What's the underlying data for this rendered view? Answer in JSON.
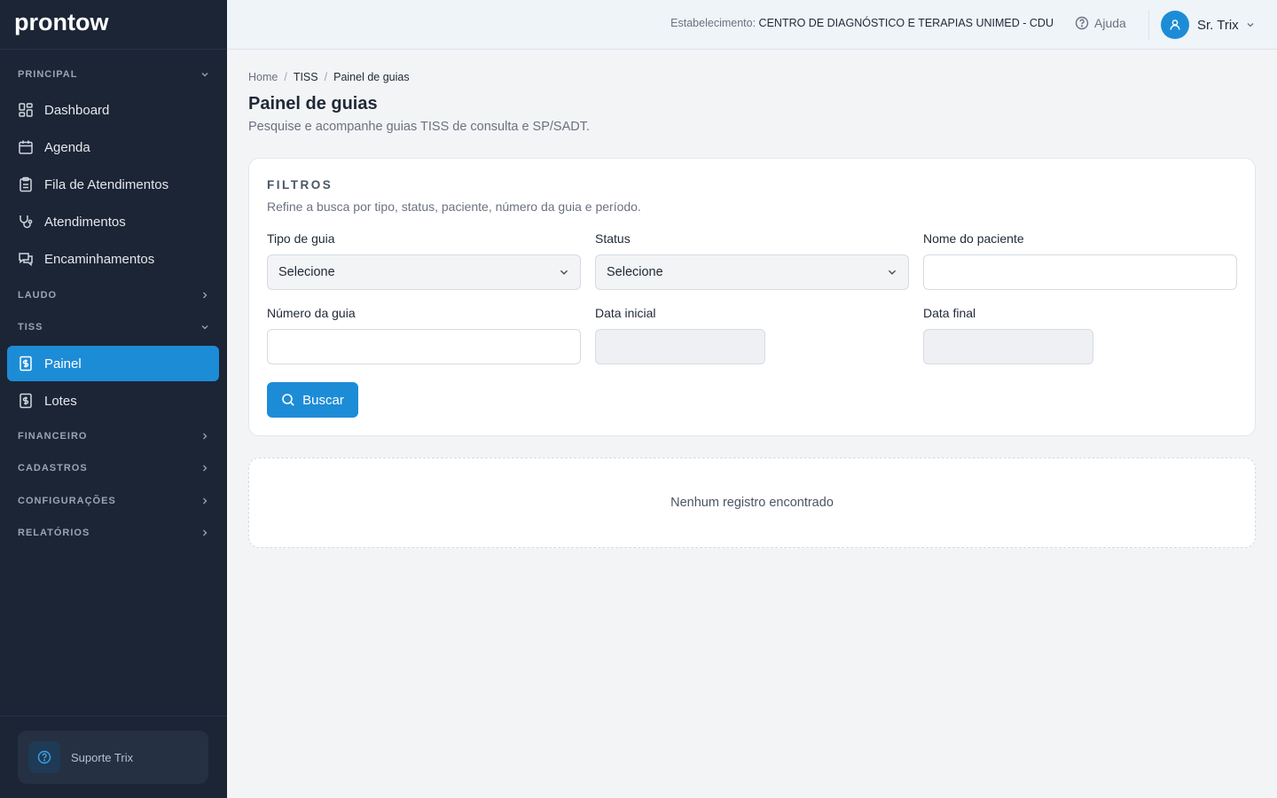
{
  "brand": {
    "logo_text": "prontow"
  },
  "sidebar": {
    "sections": {
      "principal": "PRINCIPAL",
      "laudo": "LAUDO",
      "tiss": "TISS",
      "financeiro": "FINANCEIRO",
      "cadastros": "CADASTROS",
      "configuracoes": "CONFIGURAÇÕES",
      "relatorios": "RELATÓRIOS"
    },
    "items": {
      "dashboard": "Dashboard",
      "agenda": "Agenda",
      "fila": "Fila de Atendimentos",
      "atendimentos": "Atendimentos",
      "encaminhamentos": "Encaminhamentos",
      "painel": "Painel",
      "lotes": "Lotes"
    },
    "support_label": "Suporte Trix"
  },
  "header": {
    "estab_label": "Estabelecimento:",
    "estab_value": "CENTRO DE DIAGNÓSTICO E TERAPIAS UNIMED - CDU",
    "help_label": "Ajuda",
    "user_name": "Sr. Trix"
  },
  "breadcrumb": {
    "home": "Home",
    "tiss": "TISS",
    "current": "Painel de guias"
  },
  "page": {
    "title": "Painel de guias",
    "subtitle": "Pesquise e acompanhe guias TISS de consulta e SP/SADT."
  },
  "filters": {
    "title": "FILTROS",
    "subtitle": "Refine a busca por tipo, status, paciente, número da guia e período.",
    "tipo_label": "Tipo de guia",
    "tipo_value": "Selecione",
    "status_label": "Status",
    "status_value": "Selecione",
    "paciente_label": "Nome do paciente",
    "paciente_value": "",
    "numero_label": "Número da guia",
    "numero_value": "",
    "data_inicial_label": "Data inicial",
    "data_final_label": "Data final",
    "search_button": "Buscar"
  },
  "results": {
    "empty_message": "Nenhum registro encontrado"
  },
  "colors": {
    "accent": "#1d8cd6",
    "sidebar_bg": "#1b2536",
    "page_bg": "#f3f4f6"
  }
}
